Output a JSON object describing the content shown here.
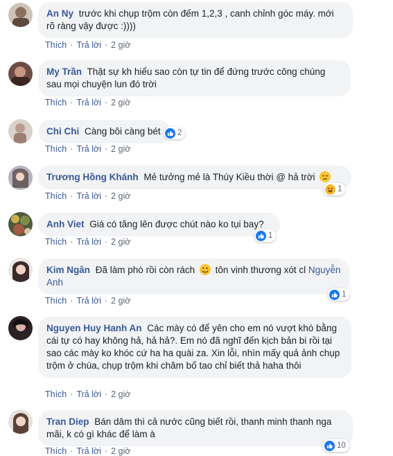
{
  "comments": [
    {
      "author": "An Ny",
      "text": "trước khi chụp trộm còn đếm 1,2,3 , canh chỉnh góc máy. mới rõ ràng vậy được :))))",
      "like": "Thích",
      "reply": "Trả lời",
      "time": "2 giờ"
    },
    {
      "author": "My Trần",
      "text": "Thật sự kh hiểu sao còn tự tin để đứng trước công chúng sau mọi chuyện lun đó trời",
      "like": "Thích",
      "reply": "Trả lời",
      "time": "2 giờ"
    },
    {
      "author": "Chi Chi",
      "text": "Càng bôi càng bét",
      "like": "Thích",
      "reply": "Trả lời",
      "time": "2 giờ",
      "reaction_count": "2",
      "reaction_icons": [
        "like-icon"
      ]
    },
    {
      "author": "Trương Hồng Khánh",
      "text": "Mẻ tưởng mẻ là Thúy Kiều thời @ hả trời",
      "emoji": "expressionless-emoji",
      "like": "Thích",
      "reply": "Trả lời",
      "time": "2 giờ",
      "reaction_count": "1",
      "reaction_icons": [
        "haha-icon"
      ]
    },
    {
      "author": "Anh Viet",
      "text": "Giá có tăng lên được chút nào ko tụi bay?",
      "like": "Thích",
      "reply": "Trả lời",
      "time": "2 giờ",
      "reaction_count": "1",
      "reaction_icons": [
        "like-icon"
      ]
    },
    {
      "author": "Kim Ngân",
      "text": "Đã làm phò rồi còn rách",
      "emoji": "smile-emoji",
      "text2": "tôn vinh thương xót cl",
      "mention": "Nguyễn Anh",
      "like": "Thích",
      "reply": "Trả lời",
      "time": "2 giờ",
      "reaction_count": "1",
      "reaction_icons": [
        "like-icon"
      ]
    },
    {
      "author": "Nguyen Huy Hanh An",
      "text": "Các mày có để yên cho em nó vượt khó bằng cái tự có hay không hả, hả hả?. Em nó đã nghĩ đến kịch bản bi rồi tại sao các mày ko khóc cứ ha ha quài za. Xin lỗi, nhìn mấy quả ảnh chụp trộm ở chùa, chụp trộm khi chăm bố tao chỉ biết thả haha thôi",
      "like": "Thích",
      "reply": "Trả lời",
      "time": "2 giờ"
    },
    {
      "author": "Tran Diep",
      "text": "Bán dâm thì cả nước cũng biết rồi, thanh minh thanh nga mãi, k có gì khác để làm à",
      "like": "Thích",
      "reply": "Trả lời",
      "time": "2 giờ",
      "reaction_count": "10",
      "reaction_icons": [
        "like-icon"
      ]
    }
  ],
  "colors": {
    "link": "#385898",
    "bubble": "#f2f3f5",
    "like_badge": "#1877f2",
    "haha_badge": "#f7b928",
    "meta": "#606770"
  }
}
